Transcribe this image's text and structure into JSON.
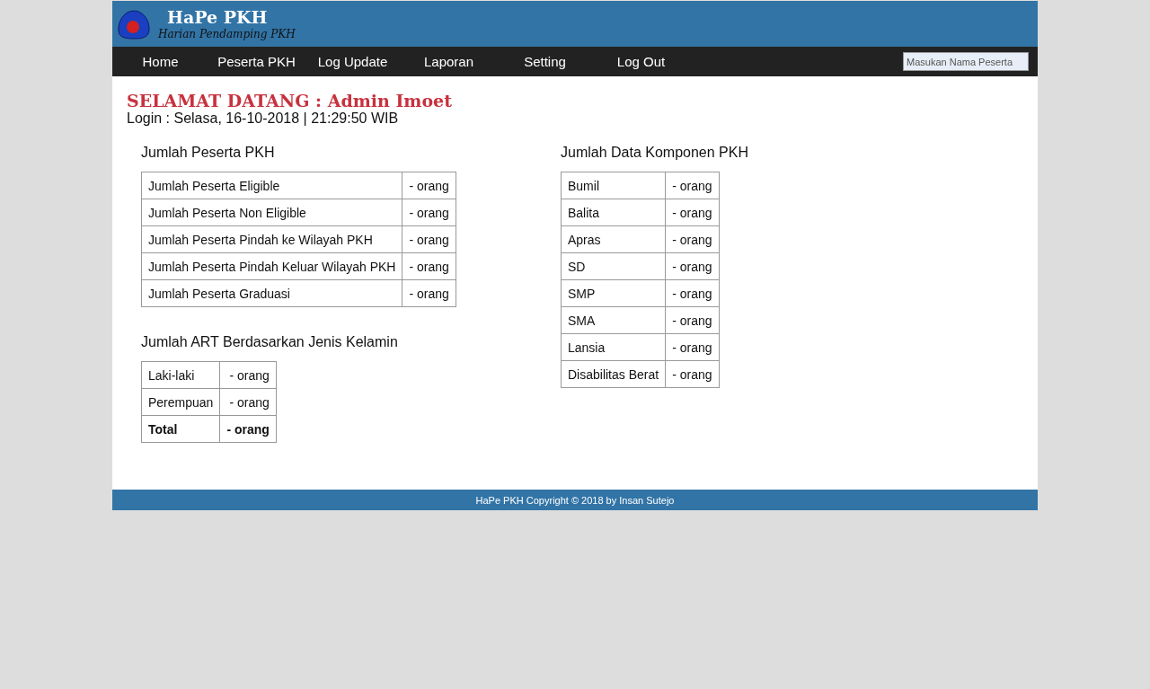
{
  "header": {
    "title": "HaPe PKH",
    "subtitle": "Harian Pendamping PKH"
  },
  "nav": {
    "items": [
      "Home",
      "Peserta PKH",
      "Log Update",
      "Laporan",
      "Setting",
      "Log Out"
    ],
    "search": {
      "placeholder": "Masukan Nama Peserta"
    }
  },
  "welcome": {
    "title": "SELAMAT DATANG : Admin Imoet",
    "login": "Login : Selasa, 16-10-2018 | 21:29:50 WIB"
  },
  "left": [
    {
      "title": "Jumlah Peserta PKH",
      "rows": [
        {
          "bold": false,
          "label": "Jumlah Peserta Eligible",
          "value": "- orang"
        },
        {
          "bold": false,
          "label": "Jumlah Peserta Non Eligible",
          "value": "- orang"
        },
        {
          "bold": false,
          "label": "Jumlah Peserta Pindah ke Wilayah PKH",
          "value": "- orang"
        },
        {
          "bold": false,
          "label": "Jumlah Peserta Pindah Keluar Wilayah PKH",
          "value": "- orang"
        },
        {
          "bold": false,
          "label": "Jumlah Peserta Graduasi",
          "value": "- orang"
        }
      ]
    },
    {
      "title": "Jumlah ART Berdasarkan Jenis Kelamin",
      "rows": [
        {
          "bold": false,
          "label": "Laki-laki",
          "value": "- orang"
        },
        {
          "bold": false,
          "label": "Perempuan",
          "value": "- orang"
        },
        {
          "bold": true,
          "label": "Total",
          "value": "- orang"
        }
      ]
    }
  ],
  "right": [
    {
      "title": "Jumlah Data Komponen PKH",
      "rows": [
        {
          "bold": false,
          "label": "Bumil",
          "value": "- orang"
        },
        {
          "bold": false,
          "label": "Balita",
          "value": "- orang"
        },
        {
          "bold": false,
          "label": "Apras",
          "value": "- orang"
        },
        {
          "bold": false,
          "label": "SD",
          "value": "- orang"
        },
        {
          "bold": false,
          "label": "SMP",
          "value": "- orang"
        },
        {
          "bold": false,
          "label": "SMA",
          "value": "- orang"
        },
        {
          "bold": false,
          "label": "Lansia",
          "value": "- orang"
        },
        {
          "bold": false,
          "label": "Disabilitas Berat",
          "value": "- orang"
        }
      ]
    }
  ],
  "footer": "HaPe PKH Copyright © 2018 by Insan Sutejo"
}
